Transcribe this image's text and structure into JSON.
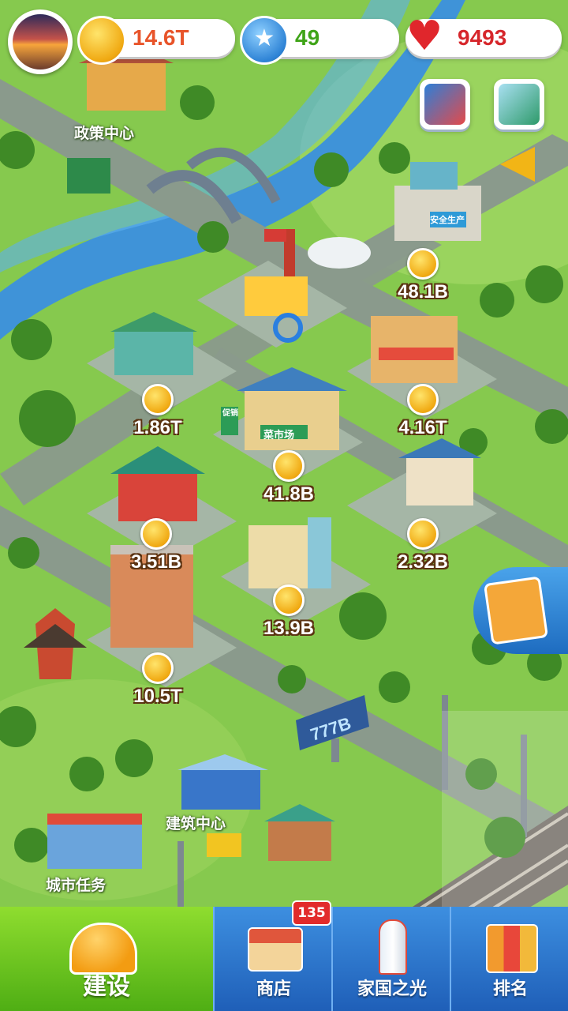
{
  "resources": {
    "coins": "14.6T",
    "stars": "49",
    "hearts": "9493"
  },
  "map_labels": {
    "policy_center": "政策中心",
    "building_center": "建筑中心",
    "city_task": "城市任务",
    "billboard": "777B"
  },
  "buildings": [
    {
      "id": "safety-factory",
      "income": "48.1B"
    },
    {
      "id": "warehouse",
      "income": "1.86T"
    },
    {
      "id": "restaurant",
      "income": "4.16T"
    },
    {
      "id": "vegetable-market",
      "income": "41.8B"
    },
    {
      "id": "chinese-building",
      "income": "3.51B"
    },
    {
      "id": "house",
      "income": "2.32B"
    },
    {
      "id": "office",
      "income": "13.9B"
    },
    {
      "id": "apartment",
      "income": "10.5T"
    }
  ],
  "sign_text": {
    "vegetable_market": "菜市场",
    "promo": "促销",
    "safety": "安全生产"
  },
  "nav": {
    "build": "建设",
    "shop": "商店",
    "shop_badge": "135",
    "homeland": "家国之光",
    "ranking": "排名"
  },
  "colors": {
    "coin_text": "#e8542a",
    "star_text": "#3fa418",
    "heart_text": "#d6262b",
    "nav_active": "#5fc21a",
    "nav_normal": "#2a72c8"
  },
  "icons": [
    "coin-icon",
    "star-icon",
    "heart-icon",
    "safety-poster-icon",
    "recycle-icon",
    "megaphone-icon",
    "edit-icon",
    "helmet-icon",
    "shop-icon",
    "rocket-icon",
    "ranking-icon"
  ]
}
